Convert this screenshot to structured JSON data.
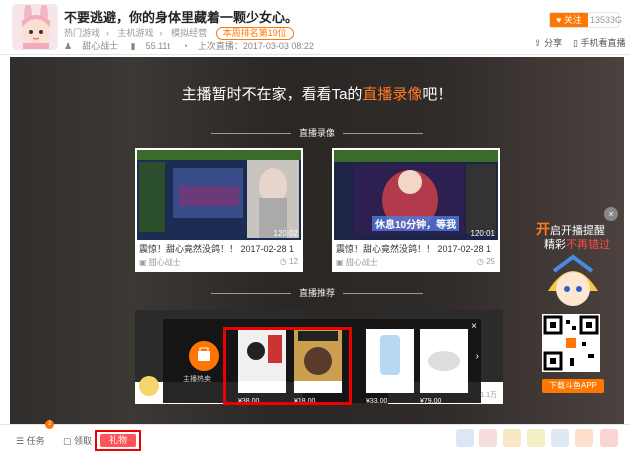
{
  "header": {
    "title": "不要逃避，你的身体里藏着一颗少女心。",
    "category1": "热门游戏",
    "category2": "主机游戏",
    "category3": "模拟经营",
    "rank_badge": "本周排名第19位",
    "streamer": "甜心战士",
    "viewers": "55.11t",
    "last_live": "上次直播：2017-03-03 08:22",
    "follow_label": "关注",
    "follow_count": "13533G",
    "share_label": "分享",
    "mobile_label": "手机看直播"
  },
  "player": {
    "offline_message_prefix": "主播暂时不在家，看看Ta的",
    "offline_message_highlight": "直播录像",
    "offline_message_suffix": "吧！",
    "section_replays": "直播录像",
    "section_recommend": "直播推荐",
    "replays": [
      {
        "title": "震惊！甜心竟然没鸽！！ 2017-02-28 1",
        "user": "甜心战士",
        "count": "12",
        "duration": "120:02"
      },
      {
        "title": "震惊！甜心竟然没鸽！！ 2017-02-28 1",
        "user": "甜心战士",
        "count": "25",
        "duration": "120:01",
        "overlay_text": "休息10分钟，等我"
      }
    ],
    "recommend_right_count": "1.1万"
  },
  "ad": {
    "icon_label": "主播热卖",
    "items": [
      {
        "price": "¥38.00"
      },
      {
        "price": "¥18.00"
      },
      {
        "price": "¥33.00"
      },
      {
        "price": "¥79.00"
      }
    ],
    "close": "×",
    "next": "›"
  },
  "promo": {
    "line1_highlight": "开",
    "line1_rest": "启开播提醒",
    "line2_prefix": "精彩",
    "line2_highlight": "不再错过",
    "download_label": "下载斗鱼APP",
    "close": "×"
  },
  "bottom": {
    "task_label": "任务",
    "task_badge": "2",
    "collect_label": "领取",
    "gift_label": "礼物"
  }
}
